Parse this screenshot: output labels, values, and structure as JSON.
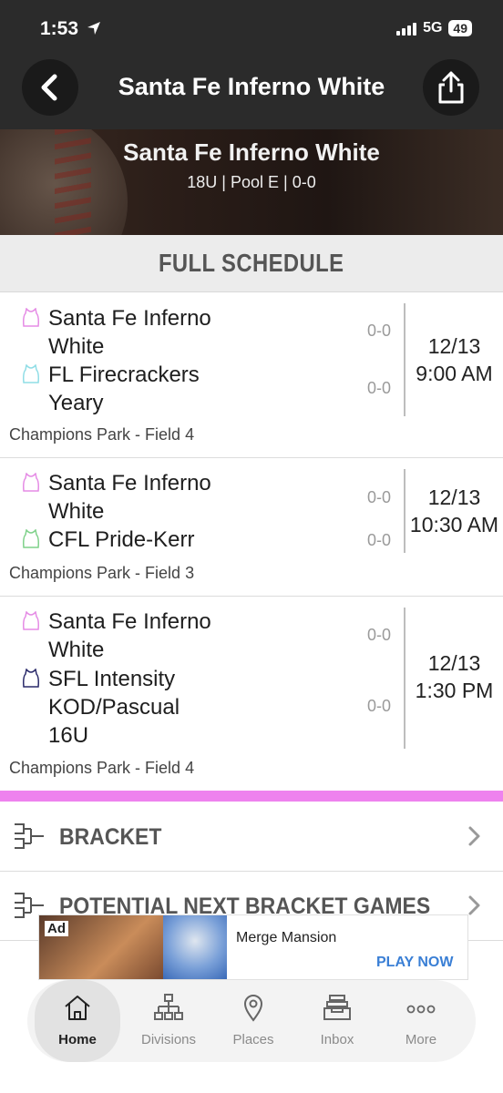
{
  "status_bar": {
    "time": "1:53",
    "network": "5G",
    "battery": "49"
  },
  "nav": {
    "title": "Santa Fe Inferno White"
  },
  "hero": {
    "title": "Santa Fe Inferno White",
    "subtitle": "18U | Pool E | 0-0"
  },
  "schedule": {
    "header": "FULL SCHEDULE",
    "games": [
      {
        "home": {
          "name": "Santa Fe Inferno White",
          "score": "0-0",
          "jersey_color": "#e58be5"
        },
        "away": {
          "name": "FL Firecrackers Yeary",
          "score": "0-0",
          "jersey_color": "#8fdde6"
        },
        "date": "12/13",
        "time": "9:00 AM",
        "venue": "Champions Park - Field 4"
      },
      {
        "home": {
          "name": "Santa Fe Inferno White",
          "score": "0-0",
          "jersey_color": "#e58be5"
        },
        "away": {
          "name": "CFL Pride-Kerr",
          "score": "0-0",
          "jersey_color": "#7fd18a"
        },
        "date": "12/13",
        "time": "10:30 AM",
        "venue": "Champions Park - Field 3"
      },
      {
        "home": {
          "name": "Santa Fe Inferno White",
          "score": "0-0",
          "jersey_color": "#e58be5"
        },
        "away": {
          "name": "SFL Intensity KOD/Pascual 16U",
          "score": "0-0",
          "jersey_color": "#2a2a6a"
        },
        "date": "12/13",
        "time": "1:30 PM",
        "venue": "Champions Park - Field 4"
      }
    ]
  },
  "links": {
    "bracket": "BRACKET",
    "next_games": "POTENTIAL NEXT BRACKET GAMES"
  },
  "ad": {
    "tag": "Ad",
    "name": "Merge Mansion",
    "cta": "PLAY NOW"
  },
  "tabs": [
    {
      "label": "Home",
      "icon": "home-icon"
    },
    {
      "label": "Divisions",
      "icon": "divisions-icon"
    },
    {
      "label": "Places",
      "icon": "location-pin-icon"
    },
    {
      "label": "Inbox",
      "icon": "inbox-icon"
    },
    {
      "label": "More",
      "icon": "more-icon"
    }
  ],
  "colors": {
    "accent_pink": "#ee82ee",
    "header_dark": "#2b2b2b",
    "link_blue": "#3a7fd5"
  }
}
